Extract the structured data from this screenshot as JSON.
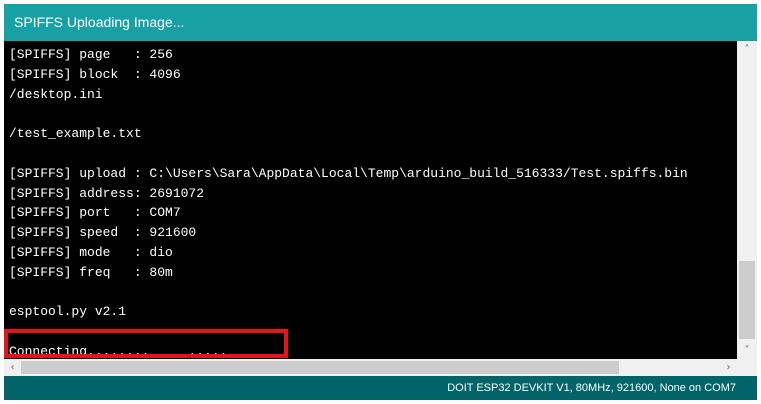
{
  "window": {
    "title": "SPIFFS Uploading Image..."
  },
  "console": {
    "lines": [
      "[SPIFFS] page   : 256",
      "[SPIFFS] block  : 4096",
      "/desktop.ini",
      "",
      "/test_example.txt",
      "",
      "[SPIFFS] upload : C:\\Users\\Sara\\AppData\\Local\\Temp\\arduino_build_516333/Test.spiffs.bin",
      "[SPIFFS] address: 2691072",
      "[SPIFFS] port   : COM7",
      "[SPIFFS] speed  : 921600",
      "[SPIFFS] mode   : dio",
      "[SPIFFS] freq   : 80m",
      "",
      "esptool.py v2.1",
      "",
      "Connecting........_____....._____"
    ]
  },
  "scrollbars": {
    "up_arrow": "˄",
    "down_arrow": "˅",
    "left_arrow": "‹",
    "right_arrow": "›"
  },
  "status_bar": {
    "text": "DOIT ESP32 DEVKIT V1, 80MHz, 921600, None on COM7"
  },
  "colors": {
    "title_bar": "#17a1a5",
    "status_bar": "#006468",
    "highlight_box": "#e3141b"
  }
}
